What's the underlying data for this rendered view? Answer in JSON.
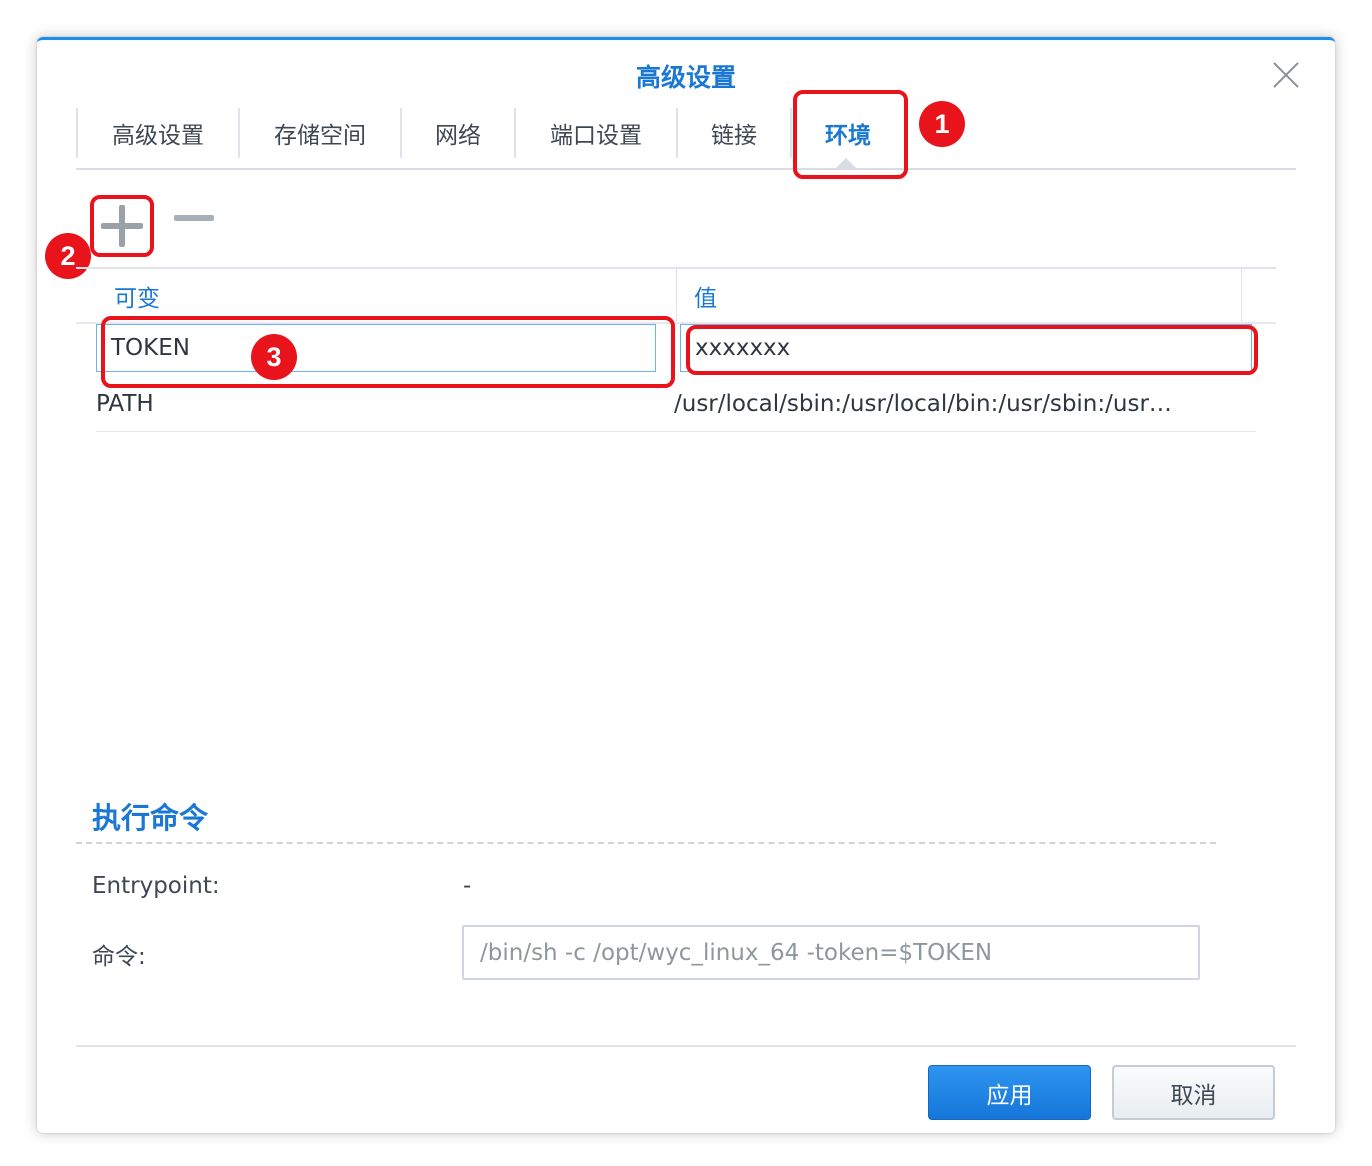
{
  "dialog": {
    "title": "高级设置"
  },
  "tabs": [
    {
      "label": "高级设置"
    },
    {
      "label": "存储空间"
    },
    {
      "label": "网络"
    },
    {
      "label": "端口设置"
    },
    {
      "label": "链接"
    },
    {
      "label": "环境",
      "active": true
    }
  ],
  "toolbar": {
    "add_icon": "plus-icon",
    "remove_icon": "minus-icon"
  },
  "env_table": {
    "columns": [
      "可变",
      "值"
    ],
    "rows": [
      {
        "variable": "TOKEN",
        "value": "xxxxxxx"
      },
      {
        "variable": "PATH",
        "value": "/usr/local/sbin:/usr/local/bin:/usr/sbin:/usr…"
      }
    ]
  },
  "annotations": [
    "1",
    "2",
    "3"
  ],
  "execute": {
    "section_title": "执行命令",
    "entrypoint_label": "Entrypoint:",
    "entrypoint_value": "-",
    "command_label": "命令:",
    "command_value": "/bin/sh -c /opt/wyc_linux_64 -token=$TOKEN"
  },
  "footer": {
    "apply_label": "应用",
    "cancel_label": "取消"
  },
  "colors": {
    "accent": "#1a78d4",
    "annotation": "#e8131b"
  }
}
